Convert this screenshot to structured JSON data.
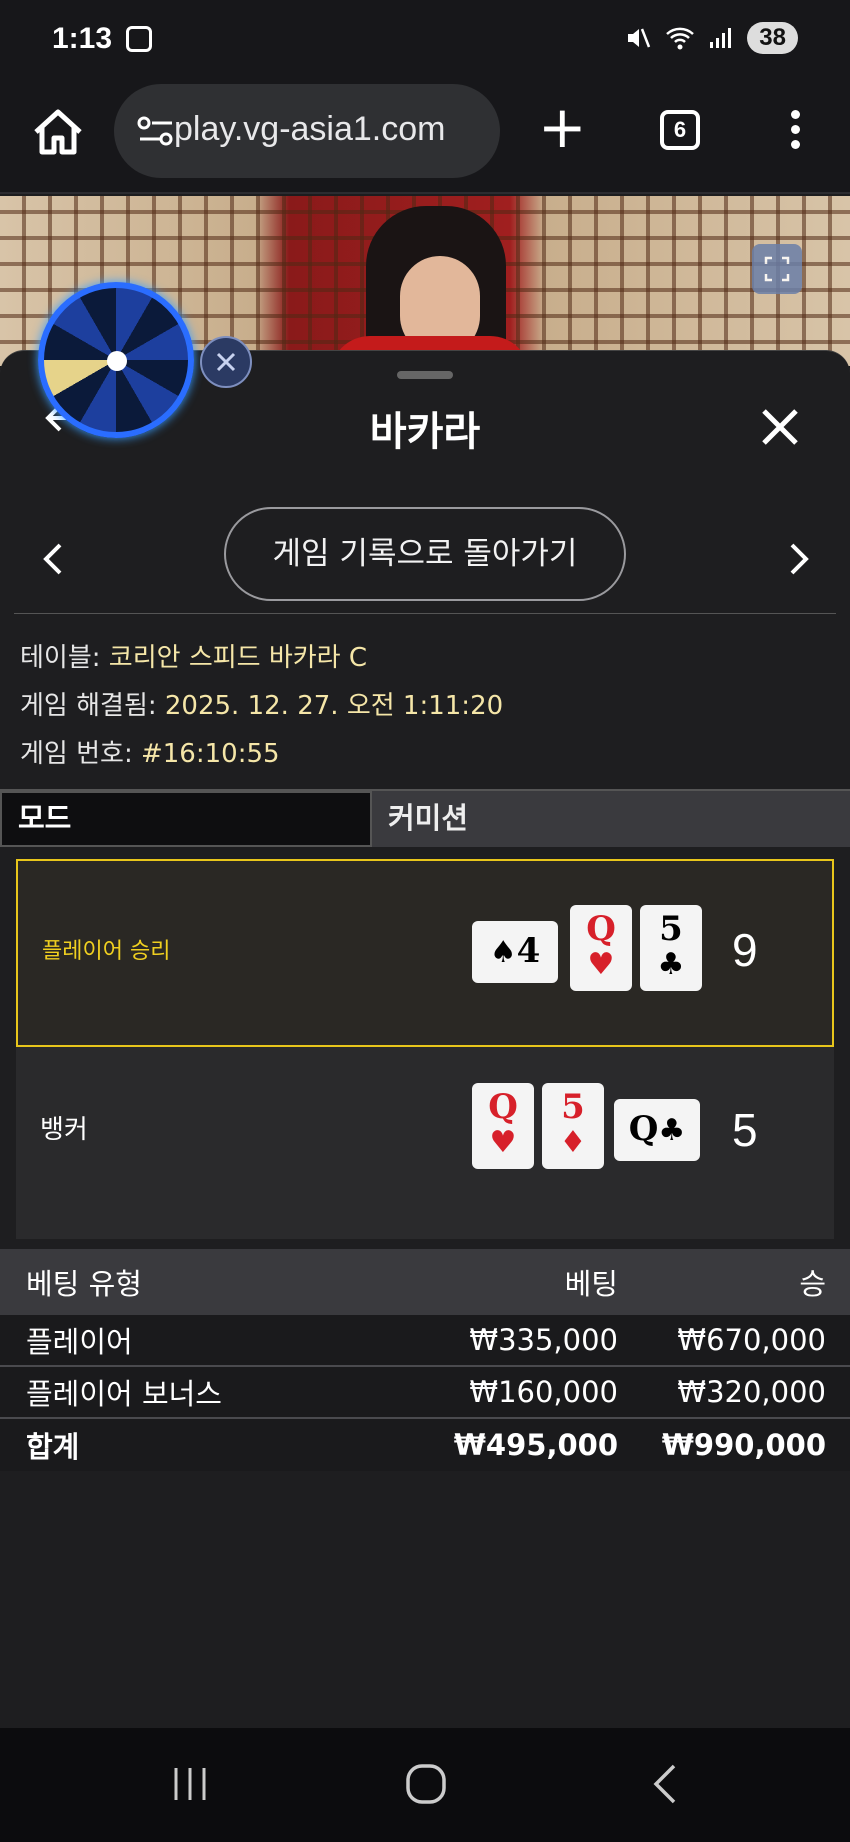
{
  "status": {
    "time": "1:13",
    "battery": "38"
  },
  "browser": {
    "url": "play.vg-asia1.com",
    "tab_count": "6"
  },
  "sheet": {
    "title": "바카라",
    "back_to_history": "게임 기록으로 돌아가기",
    "info": [
      {
        "label": "테이블: ",
        "value": "코리안 스피드 바카라 C"
      },
      {
        "label": "게임 해결됨: ",
        "value": "2025. 12. 27. 오전 1:11:20"
      },
      {
        "label": "게임 번호: ",
        "value": "#16:10:55"
      }
    ],
    "tabs": {
      "mode": "모드",
      "commission": "커미션"
    }
  },
  "results": {
    "player": {
      "label": "플레이어 승리",
      "score": "9",
      "cards": [
        {
          "rank": "4",
          "suit": "♠",
          "color": "black",
          "sideways": true
        },
        {
          "rank": "Q",
          "suit": "♥",
          "color": "red",
          "sideways": false
        },
        {
          "rank": "5",
          "suit": "♣",
          "color": "black",
          "sideways": false
        }
      ]
    },
    "banker": {
      "label": "뱅커",
      "score": "5",
      "cards": [
        {
          "rank": "Q",
          "suit": "♥",
          "color": "red",
          "sideways": false
        },
        {
          "rank": "5",
          "suit": "♦",
          "color": "red",
          "sideways": false
        },
        {
          "rank": "Q",
          "suit": "♣",
          "color": "black",
          "sideways": true
        }
      ]
    }
  },
  "bets": {
    "headers": {
      "type": "베팅 유형",
      "bet": "베팅",
      "win": "승"
    },
    "rows": [
      {
        "type": "플레이어",
        "bet": "₩335,000",
        "win": "₩670,000"
      },
      {
        "type": "플레이어 보너스",
        "bet": "₩160,000",
        "win": "₩320,000"
      }
    ],
    "total": {
      "type": "합계",
      "bet": "₩495,000",
      "win": "₩990,000"
    }
  },
  "colors": {
    "winner_border": "#e8c61b",
    "info_value": "#f5e6a8"
  }
}
